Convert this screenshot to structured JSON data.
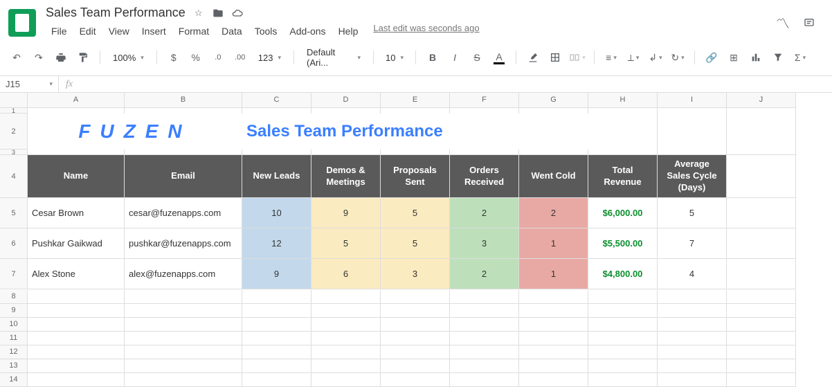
{
  "doc_title": "Sales Team Performance",
  "menu": [
    "File",
    "Edit",
    "View",
    "Insert",
    "Format",
    "Data",
    "Tools",
    "Add-ons",
    "Help"
  ],
  "status": "Last edit was seconds ago",
  "toolbar": {
    "zoom": "100%",
    "font": "Default (Ari...",
    "font_size": "10"
  },
  "name_box": "J15",
  "columns": [
    "A",
    "B",
    "C",
    "D",
    "E",
    "F",
    "G",
    "H",
    "I",
    "J"
  ],
  "row_numbers": [
    "1",
    "2",
    "3",
    "4",
    "5",
    "6",
    "7",
    "8",
    "9",
    "10",
    "11",
    "12",
    "13",
    "14"
  ],
  "brand_logo": "FUZEN",
  "page_title": "Sales Team Performance",
  "headers": {
    "name": "Name",
    "email": "Email",
    "new_leads": "New Leads",
    "demos": "Demos & Meetings",
    "proposals": "Proposals Sent",
    "orders": "Orders Received",
    "went_cold": "Went Cold",
    "revenue": "Total Revenue",
    "avg_cycle": "Average Sales Cycle (Days)"
  },
  "rows": [
    {
      "name": "Cesar Brown",
      "email": "cesar@fuzenapps.com",
      "new_leads": "10",
      "demos": "9",
      "proposals": "5",
      "orders": "2",
      "went_cold": "2",
      "revenue": "$6,000.00",
      "avg_cycle": "5"
    },
    {
      "name": "Pushkar Gaikwad",
      "email": "pushkar@fuzenapps.com",
      "new_leads": "12",
      "demos": "5",
      "proposals": "5",
      "orders": "3",
      "went_cold": "1",
      "revenue": "$5,500.00",
      "avg_cycle": "7"
    },
    {
      "name": "Alex Stone",
      "email": "alex@fuzenapps.com",
      "new_leads": "9",
      "demos": "6",
      "proposals": "3",
      "orders": "2",
      "went_cold": "1",
      "revenue": "$4,800.00",
      "avg_cycle": "4"
    }
  ]
}
